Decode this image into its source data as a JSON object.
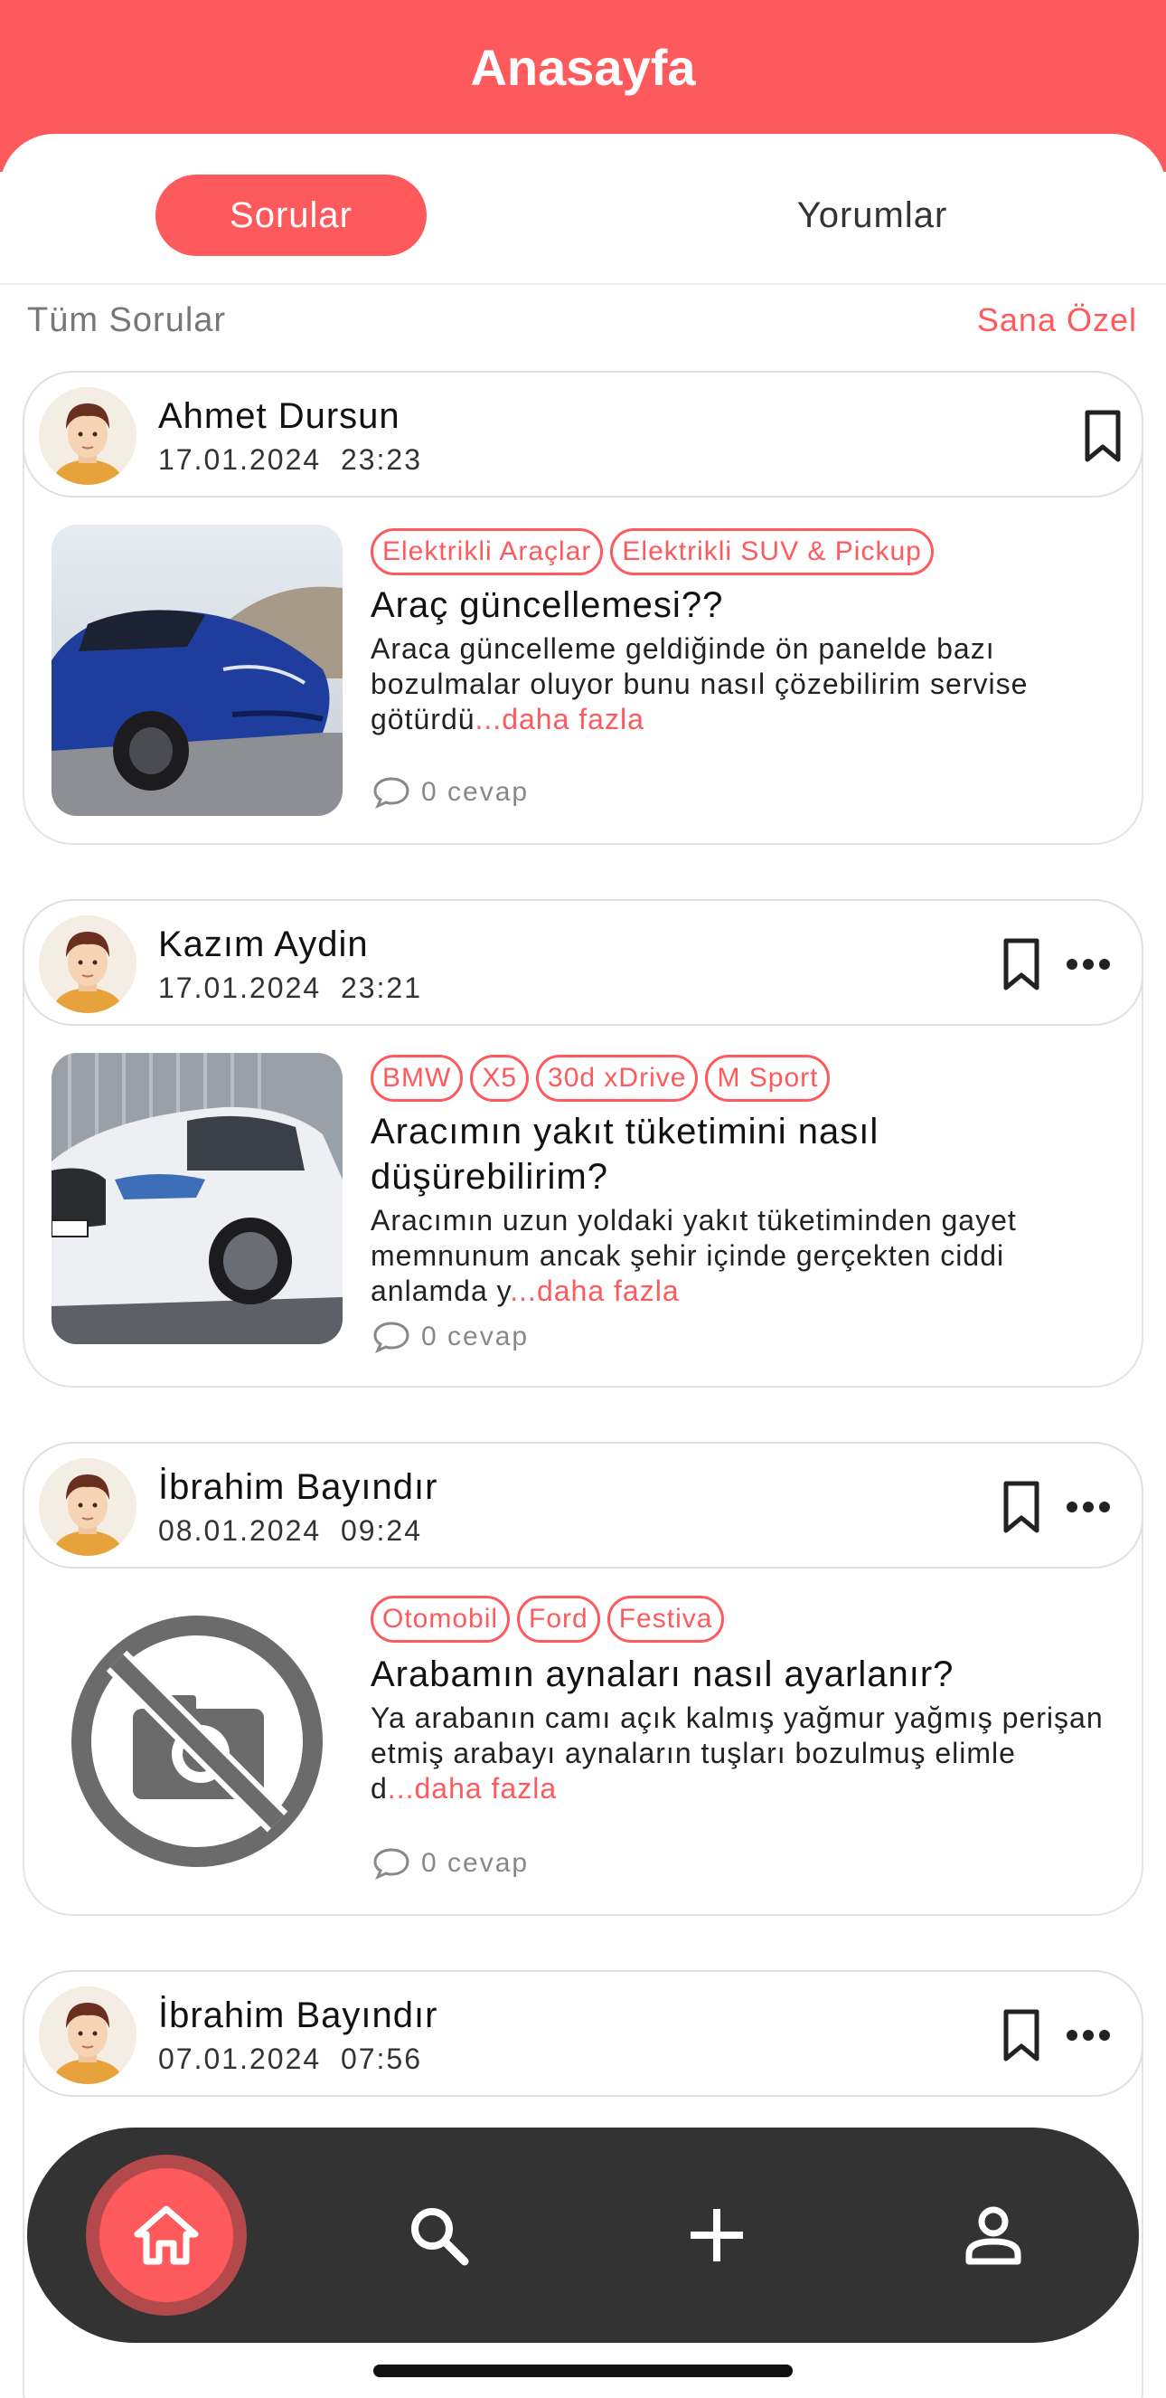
{
  "header": {
    "title": "Anasayfa"
  },
  "tabs": [
    {
      "label": "Sorular",
      "active": true
    },
    {
      "label": "Yorumlar",
      "active": false
    }
  ],
  "filter": {
    "left": "Tüm Sorular",
    "right": "Sana Özel"
  },
  "colors": {
    "accent": "#fe5a5d",
    "navbar": "#333333"
  },
  "posts": [
    {
      "author": "Ahmet Dursun",
      "date": "17.01.2024  23:23",
      "tags": [
        "Elektrikli Araçlar",
        "Elektrikli SUV & Pickup"
      ],
      "title": "Araç güncellemesi??",
      "body": "Araca güncelleme geldiğinde ön panelde bazı bozulmalar oluyor bunu nasıl çözebilirim servise götürdü",
      "more": "...daha fazla",
      "answers": "0 cevap",
      "image": "blue-ev-car"
    },
    {
      "author": "Kazım Aydin",
      "date": "17.01.2024  23:21",
      "tags": [
        "BMW",
        "X5",
        "30d xDrive",
        "M Sport"
      ],
      "title": "Aracımın yakıt tüketimini nasıl düşürebilirim?",
      "body": "Aracımın uzun yoldaki yakıt tüketiminden gayet memnunum ancak şehir içinde gerçekten ciddi anlamda y",
      "more": "...daha fazla",
      "answers": "0 cevap",
      "image": "white-suv"
    },
    {
      "author": "İbrahim Bayındır",
      "date": "08.01.2024  09:24",
      "tags": [
        "Otomobil",
        "Ford",
        "Festiva"
      ],
      "title": "Arabamın aynaları nasıl ayarlanır?",
      "body": "Ya arabanın camı açık kalmış yağmur yağmış perişan etmiş arabayı aynaların tuşları bozulmuş elimle d",
      "more": "...daha fazla",
      "answers": "0 cevap",
      "image": "no-photo-icon"
    },
    {
      "author": "İbrahim Bayındır",
      "date": "07.01.2024  07:56"
    }
  ],
  "nav": [
    "home-icon",
    "search-icon",
    "plus-icon",
    "profile-icon"
  ]
}
